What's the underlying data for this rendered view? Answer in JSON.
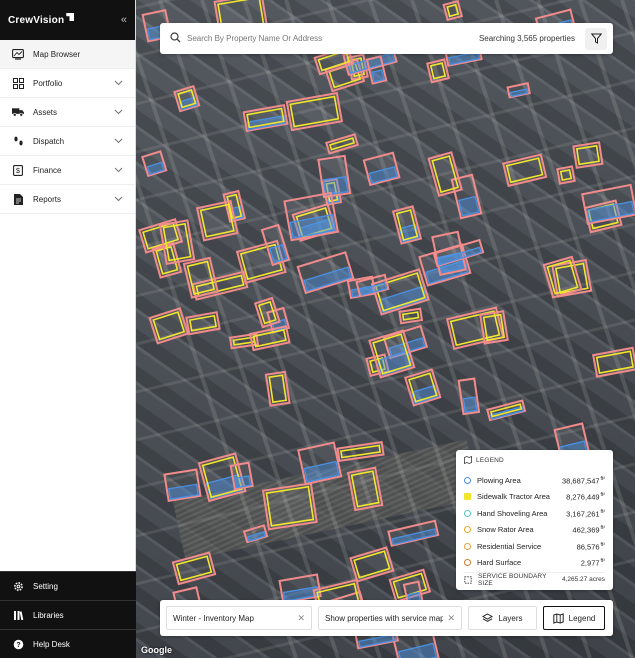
{
  "brand": {
    "name": "CrewVision"
  },
  "sidebar": {
    "items": [
      {
        "label": "Map Browser",
        "icon": "map-browser-icon",
        "active": true,
        "expandable": false
      },
      {
        "label": "Portfolio",
        "icon": "grid-icon",
        "active": false,
        "expandable": true
      },
      {
        "label": "Assets",
        "icon": "truck-icon",
        "active": false,
        "expandable": true
      },
      {
        "label": "Dispatch",
        "icon": "footprints-icon",
        "active": false,
        "expandable": true
      },
      {
        "label": "Finance",
        "icon": "dollar-icon",
        "active": false,
        "expandable": true
      },
      {
        "label": "Reports",
        "icon": "report-icon",
        "active": false,
        "expandable": true
      }
    ],
    "bottom": [
      {
        "label": "Setting",
        "icon": "gear-icon"
      },
      {
        "label": "Libraries",
        "icon": "library-icon"
      },
      {
        "label": "Help Desk",
        "icon": "help-icon"
      }
    ]
  },
  "search": {
    "placeholder": "Search By Property Name Or Address",
    "count_text": "Searching 3,565 properties"
  },
  "legend": {
    "title": "LEGEND",
    "items": [
      {
        "label": "Plowing Area",
        "value": "38,687,547",
        "unit": "ft²",
        "color": "#4a90e2",
        "shape": "circle"
      },
      {
        "label": "Sidewalk Tractor Area",
        "value": "8,276,449",
        "unit": "ft²",
        "color": "#f2e62c",
        "shape": "square"
      },
      {
        "label": "Hand Shoveling Area",
        "value": "3,167,261",
        "unit": "ft²",
        "color": "#5ec4c9",
        "shape": "circle"
      },
      {
        "label": "Snow Rator Area",
        "value": "462,369",
        "unit": "ft²",
        "color": "#e5a92b",
        "shape": "circle"
      },
      {
        "label": "Residential Service",
        "value": "86,576",
        "unit": "ft²",
        "color": "#e0a040",
        "shape": "circle"
      },
      {
        "label": "Hard Surface",
        "value": "2,977",
        "unit": "ft²",
        "color": "#d07a30",
        "shape": "circle"
      }
    ],
    "footer": {
      "label": "SERVICE BOUNDARY SIZE",
      "value": "4,265.27 acres"
    }
  },
  "toolbar": {
    "map_select": "Winter - Inventory Map",
    "filter_text": "Show properties with service map",
    "layers_label": "Layers",
    "legend_label": "Legend"
  },
  "attribution": "Google",
  "colors": {
    "boundary": "#f28b8b",
    "plowing": "#4a90e2",
    "tractor": "#f2e62c"
  }
}
